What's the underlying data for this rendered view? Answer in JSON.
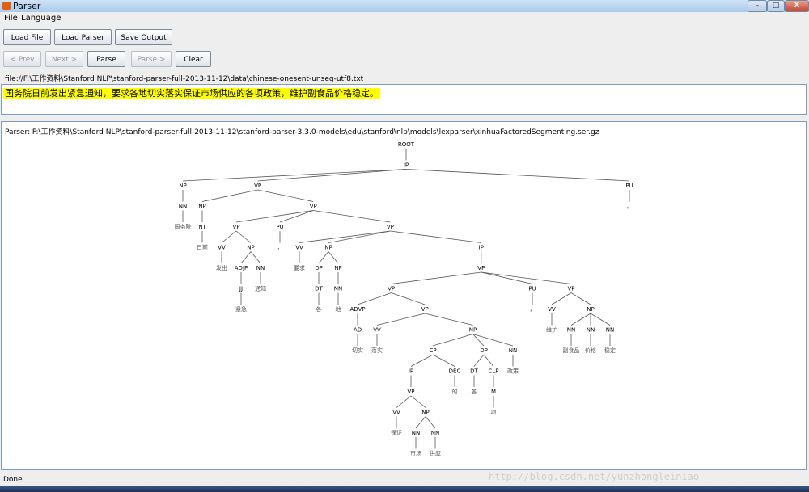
{
  "window": {
    "title": "Parser",
    "minimize": "–",
    "maximize": "□",
    "close": "X"
  },
  "menu": {
    "file": "File",
    "language": "Language"
  },
  "toolbar": {
    "load_file": "Load File",
    "load_parser": "Load Parser",
    "save_output": "Save Output",
    "prev": "< Prev",
    "next": "Next >",
    "parse": "Parse",
    "parse_next": "Parse >",
    "clear": "Clear"
  },
  "file_path": "file://F:\\工作资料\\Stanford NLP\\stanford-parser-full-2013-11-12\\data\\chinese-onesent-unseg-utf8.txt",
  "input_text": "国务院日前发出紧急通知，要求各地切实落实保证市场供应的各项政策，维护副食品价格稳定。",
  "parser_path": "Parser: F:\\工作资料\\Stanford NLP\\stanford-parser-full-2013-11-12\\stanford-parser-3.3.0-models\\edu\\stanford\\nlp\\models\\lexparser\\xinhuaFactoredSegmenting.ser.gz",
  "tree": {
    "label": "ROOT",
    "children": [
      {
        "label": "IP",
        "children": [
          {
            "label": "NP",
            "children": [
              {
                "label": "NN",
                "children": [
                  {
                    "label": "国务院"
                  }
                ]
              }
            ]
          },
          {
            "label": "VP",
            "children": [
              {
                "label": "NP",
                "children": [
                  {
                    "label": "NT",
                    "children": [
                      {
                        "label": "日前"
                      }
                    ]
                  }
                ]
              },
              {
                "label": "VP",
                "children": [
                  {
                    "label": "VP",
                    "children": [
                      {
                        "label": "VV",
                        "children": [
                          {
                            "label": "发出"
                          }
                        ]
                      },
                      {
                        "label": "NP",
                        "children": [
                          {
                            "label": "ADJP",
                            "children": [
                              {
                                "label": "JJ",
                                "children": [
                                  {
                                    "label": "紧急"
                                  }
                                ]
                              }
                            ]
                          },
                          {
                            "label": "NN",
                            "children": [
                              {
                                "label": "通知"
                              }
                            ]
                          }
                        ]
                      }
                    ]
                  },
                  {
                    "label": "PU",
                    "children": [
                      {
                        "label": "，"
                      }
                    ]
                  },
                  {
                    "label": "VP",
                    "children": [
                      {
                        "label": "VV",
                        "children": [
                          {
                            "label": "要求"
                          }
                        ]
                      },
                      {
                        "label": "NP",
                        "children": [
                          {
                            "label": "DP",
                            "children": [
                              {
                                "label": "DT",
                                "children": [
                                  {
                                    "label": "各"
                                  }
                                ]
                              }
                            ]
                          },
                          {
                            "label": "NP",
                            "children": [
                              {
                                "label": "NN",
                                "children": [
                                  {
                                    "label": "地"
                                  }
                                ]
                              }
                            ]
                          }
                        ]
                      },
                      {
                        "label": "IP",
                        "children": [
                          {
                            "label": "VP",
                            "children": [
                              {
                                "label": "VP",
                                "children": [
                                  {
                                    "label": "ADVP",
                                    "children": [
                                      {
                                        "label": "AD",
                                        "children": [
                                          {
                                            "label": "切实"
                                          }
                                        ]
                                      }
                                    ]
                                  },
                                  {
                                    "label": "VP",
                                    "children": [
                                      {
                                        "label": "VV",
                                        "children": [
                                          {
                                            "label": "落实"
                                          }
                                        ]
                                      },
                                      {
                                        "label": "NP",
                                        "children": [
                                          {
                                            "label": "CP",
                                            "children": [
                                              {
                                                "label": "IP",
                                                "children": [
                                                  {
                                                    "label": "VP",
                                                    "children": [
                                                      {
                                                        "label": "VV",
                                                        "children": [
                                                          {
                                                            "label": "保证"
                                                          }
                                                        ]
                                                      },
                                                      {
                                                        "label": "NP",
                                                        "children": [
                                                          {
                                                            "label": "NN",
                                                            "children": [
                                                              {
                                                                "label": "市场"
                                                              }
                                                            ]
                                                          },
                                                          {
                                                            "label": "NN",
                                                            "children": [
                                                              {
                                                                "label": "供应"
                                                              }
                                                            ]
                                                          }
                                                        ]
                                                      }
                                                    ]
                                                  }
                                                ]
                                              },
                                              {
                                                "label": "DEC",
                                                "children": [
                                                  {
                                                    "label": "的"
                                                  }
                                                ]
                                              }
                                            ]
                                          },
                                          {
                                            "label": "DP",
                                            "children": [
                                              {
                                                "label": "DT",
                                                "children": [
                                                  {
                                                    "label": "各"
                                                  }
                                                ]
                                              },
                                              {
                                                "label": "CLP",
                                                "children": [
                                                  {
                                                    "label": "M",
                                                    "children": [
                                                      {
                                                        "label": "项"
                                                      }
                                                    ]
                                                  }
                                                ]
                                              }
                                            ]
                                          },
                                          {
                                            "label": "NN",
                                            "children": [
                                              {
                                                "label": "政策"
                                              }
                                            ]
                                          }
                                        ]
                                      }
                                    ]
                                  }
                                ]
                              },
                              {
                                "label": "PU",
                                "children": [
                                  {
                                    "label": "，"
                                  }
                                ]
                              },
                              {
                                "label": "VP",
                                "children": [
                                  {
                                    "label": "VV",
                                    "children": [
                                      {
                                        "label": "维护"
                                      }
                                    ]
                                  },
                                  {
                                    "label": "NP",
                                    "children": [
                                      {
                                        "label": "NN",
                                        "children": [
                                          {
                                            "label": "副食品"
                                          }
                                        ]
                                      },
                                      {
                                        "label": "NN",
                                        "children": [
                                          {
                                            "label": "价格"
                                          }
                                        ]
                                      },
                                      {
                                        "label": "NN",
                                        "children": [
                                          {
                                            "label": "稳定"
                                          }
                                        ]
                                      }
                                    ]
                                  }
                                ]
                              }
                            ]
                          }
                        ]
                      }
                    ]
                  }
                ]
              }
            ]
          },
          {
            "label": "PU",
            "children": [
              {
                "label": "。"
              }
            ]
          }
        ]
      }
    ]
  },
  "status": "Done",
  "watermark": "http://blog.csdn.net/yunzhongleiniao"
}
